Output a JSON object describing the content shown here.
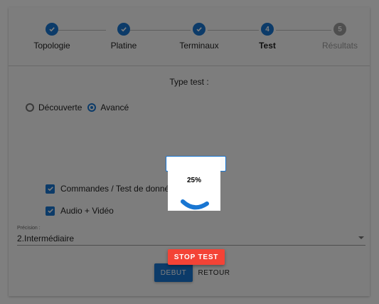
{
  "stepper": {
    "steps": [
      {
        "label": "Topologie",
        "state": "done",
        "marker": "check"
      },
      {
        "label": "Platine",
        "state": "done",
        "marker": "check"
      },
      {
        "label": "Terminaux",
        "state": "done",
        "marker": "check"
      },
      {
        "label": "Test",
        "state": "active",
        "marker": "4"
      },
      {
        "label": "Résultats",
        "state": "pending",
        "marker": "5"
      }
    ]
  },
  "form": {
    "type_title": "Type test :",
    "radios": [
      {
        "label": "Découverte",
        "checked": false
      },
      {
        "label": "Avancé",
        "checked": true
      }
    ],
    "checkboxes": [
      {
        "label": "Commandes / Test de données",
        "checked": true
      },
      {
        "label": "Audio + Vidéo",
        "checked": true
      }
    ],
    "precision": {
      "label": "Précision :",
      "value": "2.Intermédiaire"
    }
  },
  "buttons": {
    "debut": "DEBUT",
    "retour": "RETOUR",
    "stop": "STOP TEST"
  },
  "progress": {
    "text": "25%",
    "value": 0.25
  },
  "colors": {
    "primary": "#1976d2",
    "danger": "#f44336",
    "pending": "#9e9e9e"
  },
  "icons": {
    "done": "check-icon",
    "select": "dropdown-arrow-icon"
  }
}
